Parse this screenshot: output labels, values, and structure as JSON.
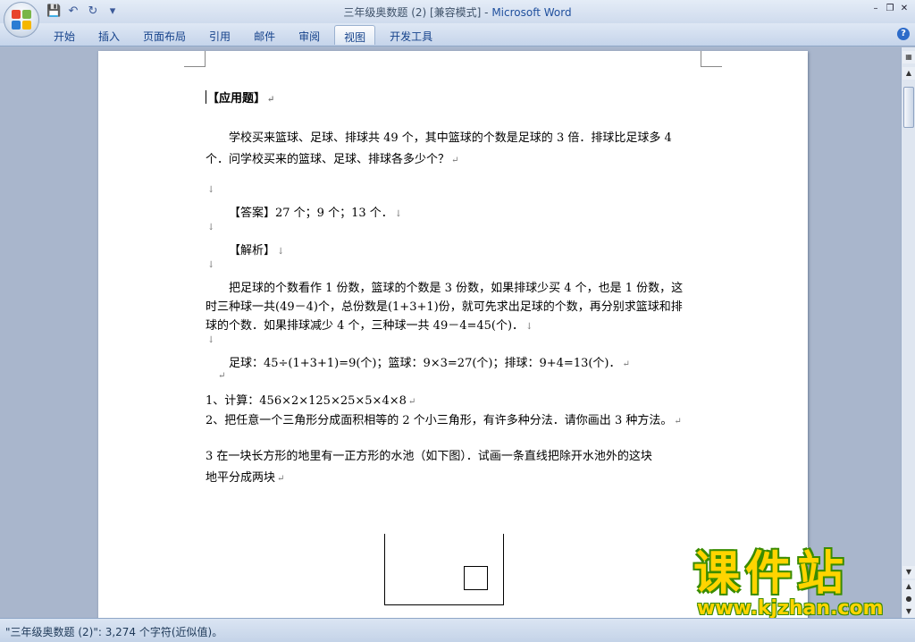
{
  "window": {
    "title": "三年级奥数题 (2) [兼容模式] - ",
    "app_name": "Microsoft Word"
  },
  "qat": {
    "icons": [
      "save-icon",
      "undo-icon",
      "redo-icon",
      "customize-icon"
    ]
  },
  "ribbon": {
    "tabs": [
      "开始",
      "插入",
      "页面布局",
      "引用",
      "邮件",
      "审阅",
      "视图",
      "开发工具"
    ],
    "active_tab": "视图"
  },
  "document": {
    "heading": "【应用题】",
    "problem_line1": "学校买来篮球、足球、排球共 49 个，其中篮球的个数是足球的 3 倍．排球比足球多 4",
    "problem_line2": "个．问学校买来的篮球、足球、排球各多少个？",
    "answer": "【答案】27 个；9 个；13 个．",
    "analysis_label": "【解析】",
    "analysis_line1": "把足球的个数看作 1 份数，篮球的个数是 3 份数，如果排球少买 4 个，也是 1 份数，这",
    "analysis_line2": "时三种球一共(49－4)个，总份数是(1+3+1)份，就可先求出足球的个数，再分别求篮球和排",
    "analysis_line3": "球的个数．如果排球减少 4 个，三种球一共 49－4=45(个)．",
    "solution": "足球：45÷(1+3+1)=9(个)；篮球：9×3=27(个)；排球：9+4=13(个)．",
    "q1": "1、计算：456×2×125×25×5×4×8",
    "q2": "2、把任意一个三角形分成面积相等的 2 个小三角形，有许多种分法．请你画出 3 种方法。",
    "q3_line1": "3   在一块长方形的地里有一正方形的水池（如下图）．试画一条直线把除开水池外的这块",
    "q3_line2": "地平分成两块"
  },
  "watermark": {
    "brand": "课件站",
    "url": "www.kjzhan.com"
  },
  "status": {
    "text": "\"三年级奥数题 (2)\": 3,274 个字符(近似值)。"
  },
  "colors": {
    "accent": "#15428b",
    "workspace": "#a9b6cc",
    "watermark_fill": "#ffd400",
    "watermark_outline": "#3a8c00"
  }
}
